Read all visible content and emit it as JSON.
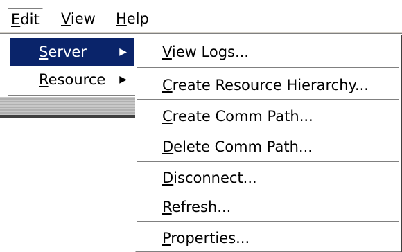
{
  "menubar": {
    "edit": {
      "prefix": "E",
      "rest": "dit"
    },
    "view": {
      "prefix": "V",
      "rest": "iew"
    },
    "help": {
      "prefix": "H",
      "rest": "elp"
    }
  },
  "edit_menu": {
    "items": [
      {
        "prefix": "S",
        "rest": "erver",
        "arrow": "▶",
        "highlighted": true
      },
      {
        "prefix": "R",
        "rest": "esource",
        "arrow": "▶",
        "highlighted": false
      }
    ]
  },
  "server_menu": {
    "items": [
      {
        "prefix": "V",
        "rest": "iew Logs..."
      },
      {
        "prefix": "C",
        "rest": "reate Resource Hierarchy..."
      },
      {
        "prefix": "C",
        "rest": "reate Comm Path..."
      },
      {
        "prefix": "D",
        "rest": "elete Comm Path..."
      },
      {
        "prefix": "D",
        "rest": "isconnect..."
      },
      {
        "prefix": "R",
        "rest": "efresh..."
      },
      {
        "prefix": "P",
        "rest": "roperties..."
      }
    ]
  },
  "colors": {
    "highlight_bg": "#0a246a",
    "highlight_text": "#ffffff",
    "menu_bg": "#ffffff",
    "separator": "#808080"
  }
}
